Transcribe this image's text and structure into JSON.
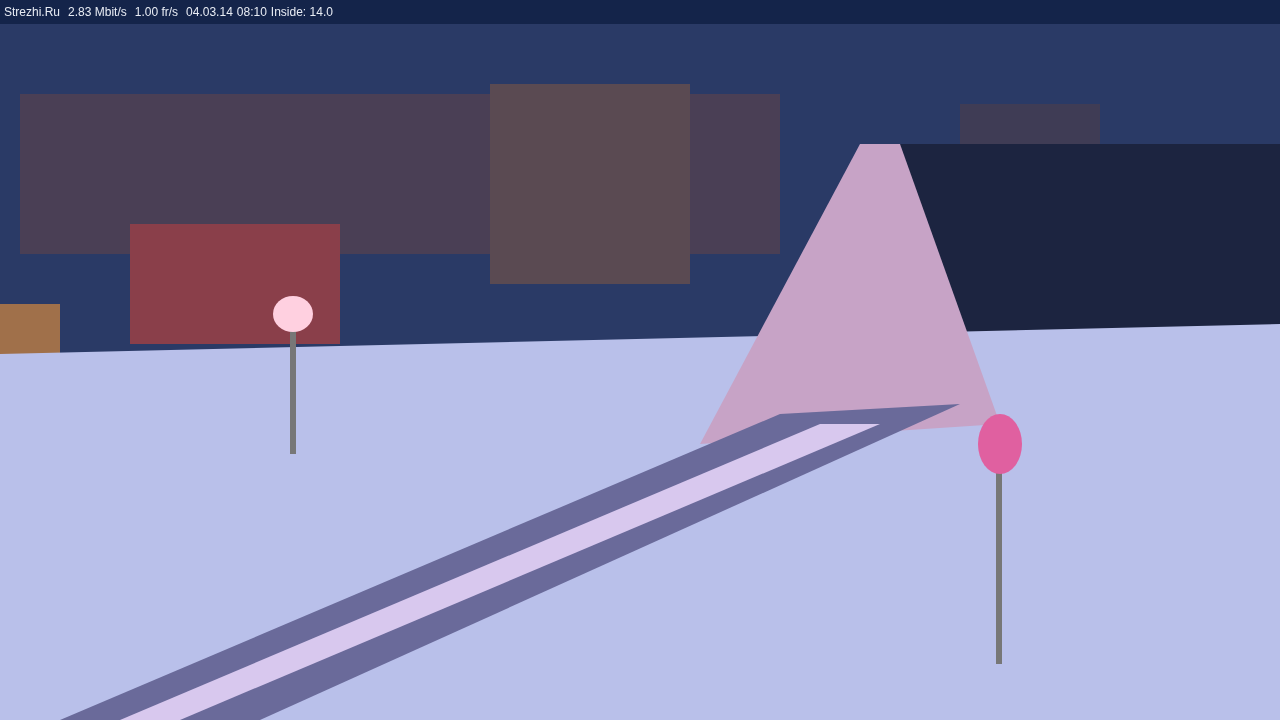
{
  "status_bar": {
    "site": "Strezhi.Ru",
    "bitrate": "2.83 Mbit/s",
    "frame_rate": "1.00 fr/s",
    "date": "04.03.14",
    "time": "08:10",
    "inside": "Inside: 14.0"
  }
}
